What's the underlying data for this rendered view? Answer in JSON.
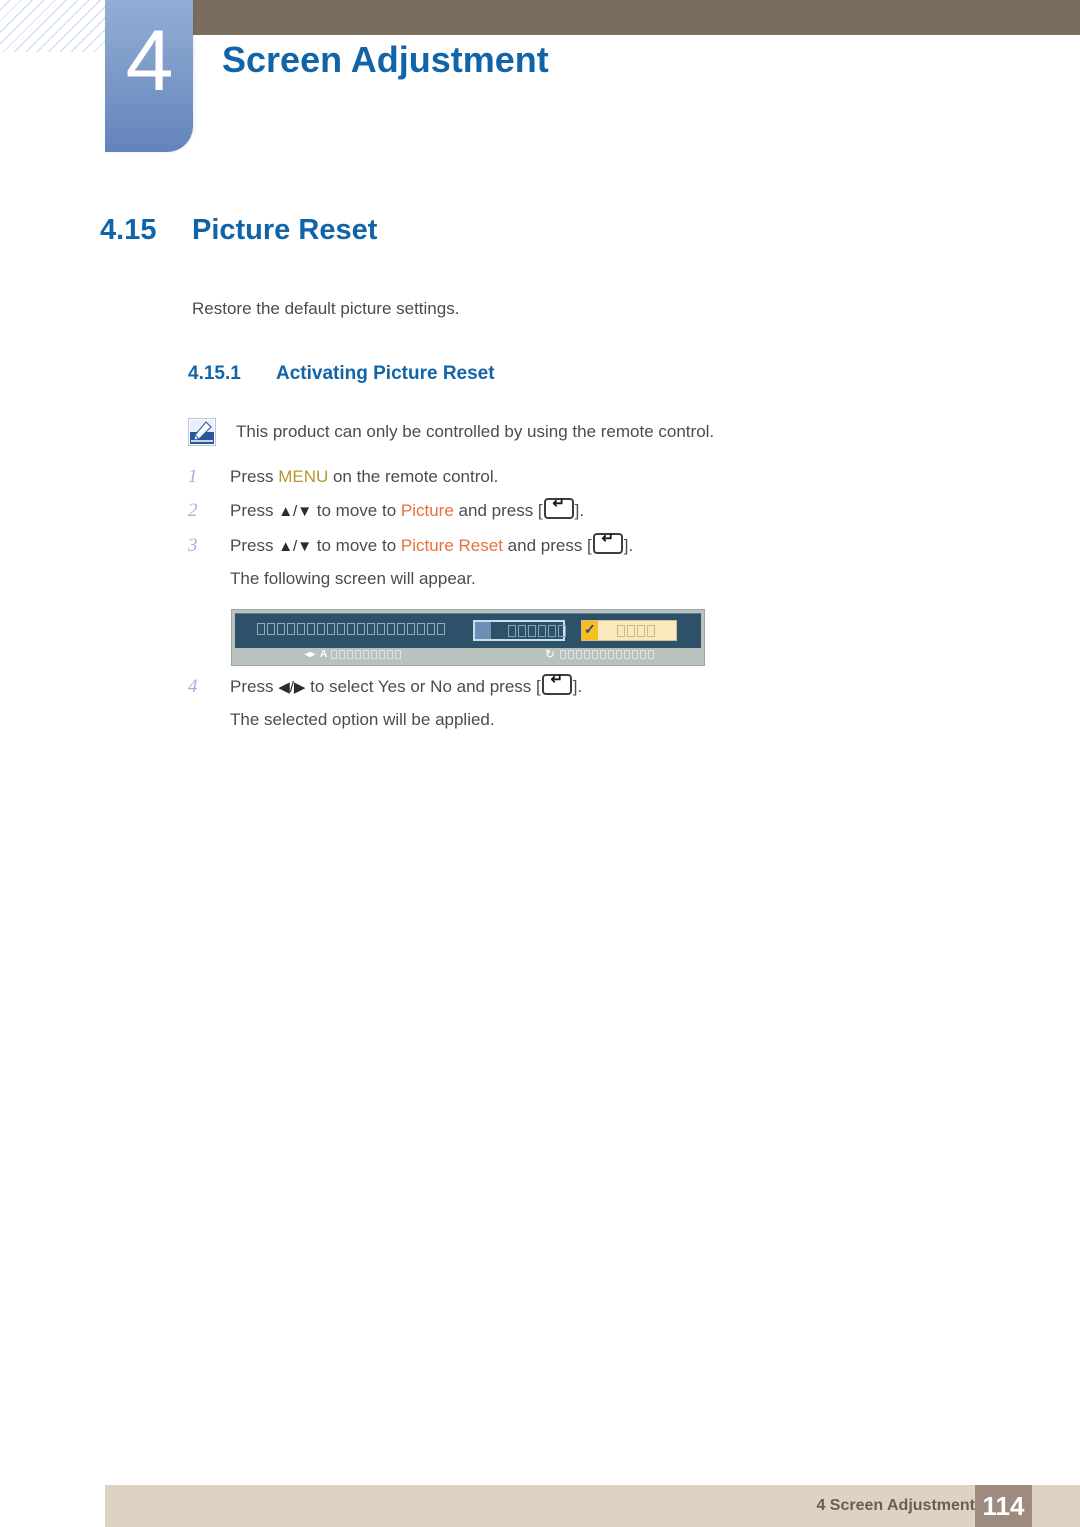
{
  "header": {
    "chapter_number": "4",
    "chapter_title": "Screen Adjustment"
  },
  "section": {
    "number": "4.15",
    "title": "Picture Reset",
    "intro": "Restore the default picture settings."
  },
  "subsection": {
    "number": "4.15.1",
    "title": "Activating Picture Reset"
  },
  "note": {
    "icon": "note-pen-icon",
    "text": "This product can only be controlled by using the remote control."
  },
  "steps": [
    {
      "number": "1",
      "pre": "Press ",
      "highlight": "MENU",
      "highlight_color": "#b8942f",
      "post": " on the remote control.",
      "sub": ""
    },
    {
      "number": "2",
      "pre": "Press ",
      "arrows": "▲/▼",
      "mid": " to move to ",
      "highlight": "Picture",
      "highlight_color": "#e8703a",
      "post": " and press [",
      "key": "enter-key-icon",
      "tail": "].",
      "sub": ""
    },
    {
      "number": "3",
      "pre": "Press ",
      "arrows": "▲/▼",
      "mid": " to move to ",
      "highlight": "Picture Reset",
      "highlight_color": "#e8703a",
      "post": " and press [",
      "key": "enter-key-icon",
      "tail": "].",
      "sub": "The following screen will appear."
    },
    {
      "number": "4",
      "pre": "Press ",
      "arrows": "◀/▶",
      "mid": " to select Yes or No and press [",
      "highlight": "",
      "highlight_color": "",
      "post": "",
      "key": "enter-key-icon",
      "tail": "].",
      "sub": "The selected option will be applied."
    }
  ],
  "osd": {
    "title_glyph_count": 19,
    "button_no": {
      "glyph_count": 6,
      "selected": false
    },
    "button_yes": {
      "glyph_count": 4,
      "selected": true,
      "check": "✓"
    },
    "footer_left": {
      "icon": "left-right-arrow-icon",
      "letter": "A",
      "glyph_count": 9
    },
    "footer_right": {
      "icon": "return-arrow-icon",
      "glyph_count": 12
    },
    "colors": {
      "panel": "#2c5169",
      "frame": "#b9c2bd",
      "highlight_yellow": "#fae9bc",
      "accent_gold": "#f5c01e"
    }
  },
  "footer": {
    "text": "4 Screen Adjustment",
    "page": "114"
  },
  "colors": {
    "heading_blue": "#1164a8",
    "chapter_badge": "#7e9bc9",
    "header_brown": "#7b6d5e",
    "footer_tan": "#ded2c2",
    "footer_page_brown": "#9d8b80",
    "body_text": "#4c4c4c",
    "step_number": "#9fb2dd"
  }
}
